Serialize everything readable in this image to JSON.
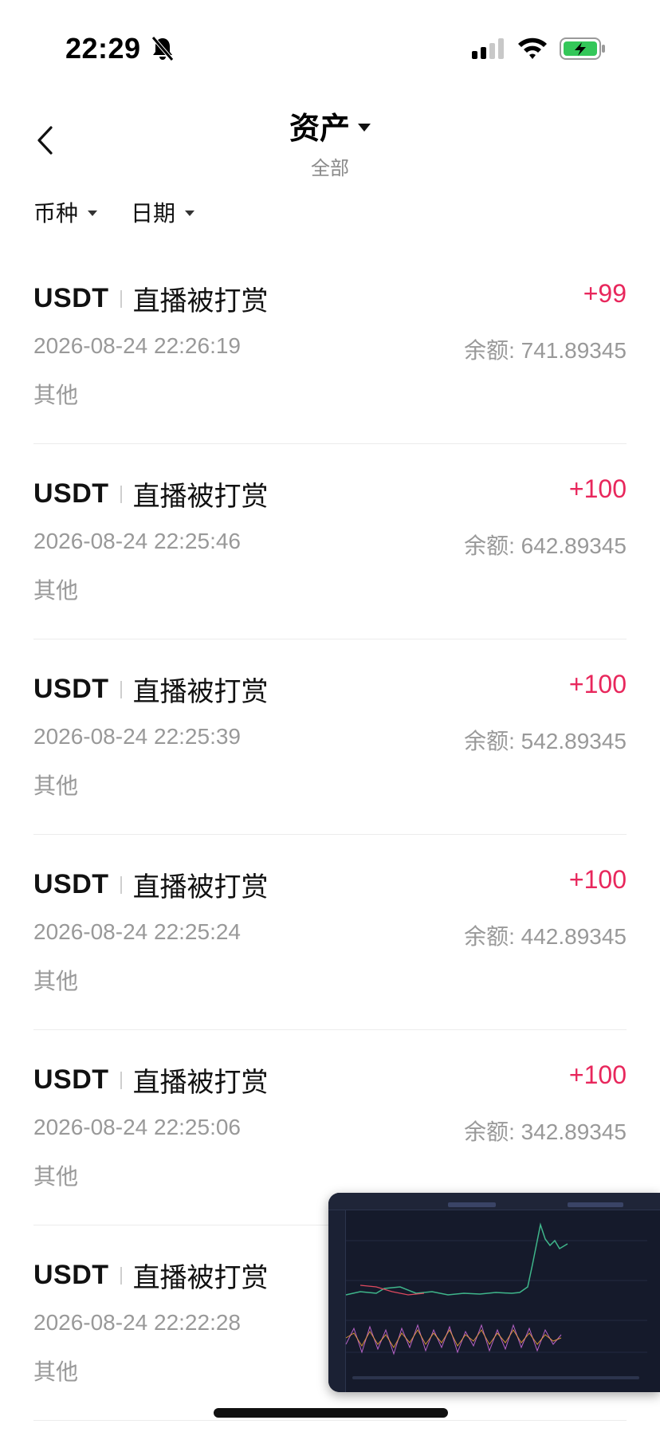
{
  "status_bar": {
    "time": "22:29",
    "bell_icon": "bell-slash-icon",
    "signal_icon": "cellular-signal-icon",
    "wifi_icon": "wifi-icon",
    "battery_icon": "battery-charging-icon",
    "battery_color": "#34c759"
  },
  "header": {
    "back_icon": "chevron-left-icon",
    "title": "资产",
    "subtitle": "全部"
  },
  "filters": [
    {
      "label": "币种"
    },
    {
      "label": "日期"
    }
  ],
  "colors": {
    "positive_amount": "#e8275c",
    "secondary_text": "#999999"
  },
  "transactions": [
    {
      "currency": "USDT",
      "type": "直播被打赏",
      "amount": "+99",
      "datetime": "2026-08-24 22:26:19",
      "balance": "余额: 741.89345",
      "category": "其他"
    },
    {
      "currency": "USDT",
      "type": "直播被打赏",
      "amount": "+100",
      "datetime": "2026-08-24 22:25:46",
      "balance": "余额: 642.89345",
      "category": "其他"
    },
    {
      "currency": "USDT",
      "type": "直播被打赏",
      "amount": "+100",
      "datetime": "2026-08-24 22:25:39",
      "balance": "余额: 542.89345",
      "category": "其他"
    },
    {
      "currency": "USDT",
      "type": "直播被打赏",
      "amount": "+100",
      "datetime": "2026-08-24 22:25:24",
      "balance": "余额: 442.89345",
      "category": "其他"
    },
    {
      "currency": "USDT",
      "type": "直播被打赏",
      "amount": "+100",
      "datetime": "2026-08-24 22:25:06",
      "balance": "余额: 342.89345",
      "category": "其他"
    },
    {
      "currency": "USDT",
      "type": "直播被打赏",
      "amount": "",
      "datetime": "2026-08-24 22:22:28",
      "balance": "",
      "category": "其他"
    }
  ],
  "pip": {
    "content": "trading-chart-video-thumbnail"
  }
}
